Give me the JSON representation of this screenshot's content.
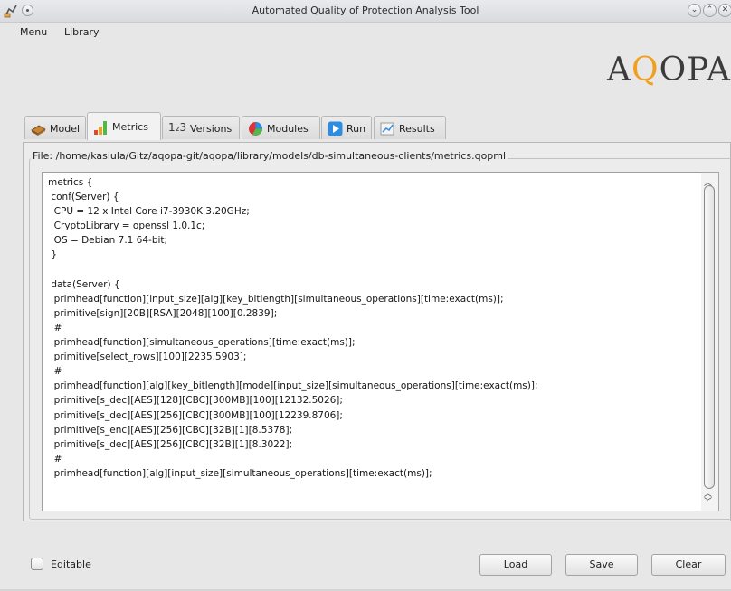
{
  "window": {
    "title": "Automated Quality of Protection Analysis Tool",
    "minimize": "⌄",
    "maximize": "⌃",
    "close": "✕"
  },
  "menu": {
    "items": [
      "Menu",
      "Library"
    ]
  },
  "logo": {
    "a": "A",
    "q": "Q",
    "opa": "OPA"
  },
  "tabs": [
    {
      "label": "Model",
      "icon": "model-icon"
    },
    {
      "label": "Metrics",
      "icon": "bar-chart-icon"
    },
    {
      "label": "Versions",
      "icon": "versions-123-icon",
      "prefix": "1₂3"
    },
    {
      "label": "Modules",
      "icon": "modules-pie-icon"
    },
    {
      "label": "Run",
      "icon": "run-play-icon"
    },
    {
      "label": "Results",
      "icon": "results-icon"
    }
  ],
  "file_label": "File: /home/kasiula/Gitz/aqopa-git/aqopa/library/models/db-simultaneous-clients/metrics.qopml",
  "code": "metrics {\n conf(Server) {\n  CPU = 12 x Intel Core i7-3930K 3.20GHz;\n  CryptoLibrary = openssl 1.0.1c;\n  OS = Debian 7.1 64-bit;\n }\n\n data(Server) {\n  primhead[function][input_size][alg][key_bitlength][simultaneous_operations][time:exact(ms)];\n  primitive[sign][20B][RSA][2048][100][0.2839];\n  #\n  primhead[function][simultaneous_operations][time:exact(ms)];\n  primitive[select_rows][100][2235.5903];\n  #\n  primhead[function][alg][key_bitlength][mode][input_size][simultaneous_operations][time:exact(ms)];\n  primitive[s_dec][AES][128][CBC][300MB][100][12132.5026];\n  primitive[s_dec][AES][256][CBC][300MB][100][12239.8706];\n  primitive[s_enc][AES][256][CBC][32B][1][8.5378];\n  primitive[s_dec][AES][256][CBC][32B][1][8.3022];\n  #\n  primhead[function][alg][input_size][simultaneous_operations][time:exact(ms)];",
  "editable_label": "Editable",
  "buttons": {
    "load": "Load",
    "save": "Save",
    "clear": "Clear"
  },
  "colors": {
    "logo_q": "#f0a020",
    "run_icon": "#2e8de0",
    "modules_icon": "#d9343a"
  }
}
